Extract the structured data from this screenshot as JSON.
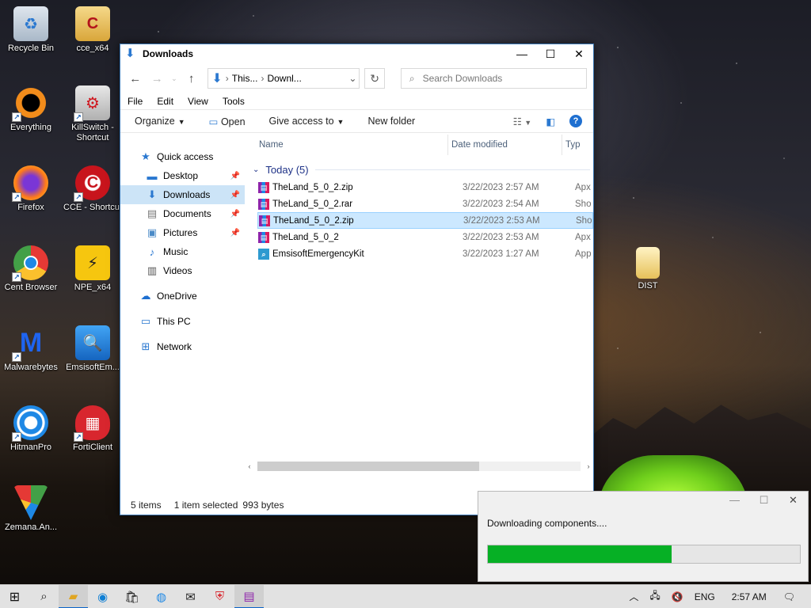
{
  "desktop": {
    "icons": [
      {
        "label": "Recycle Bin",
        "icon": "recycle-bin-icon"
      },
      {
        "label": "cce_x64",
        "icon": "archive-folder-icon"
      },
      {
        "label": "Everything",
        "icon": "everything-search-icon"
      },
      {
        "label": "KillSwitch - Shortcut",
        "icon": "killswitch-icon"
      },
      {
        "label": "Firefox",
        "icon": "firefox-icon"
      },
      {
        "label": "CCE - Shortcut",
        "icon": "cce-icon"
      },
      {
        "label": "Cent Browser",
        "icon": "cent-browser-icon"
      },
      {
        "label": "NPE_x64",
        "icon": "npe-icon"
      },
      {
        "label": "Malwarebytes",
        "icon": "malwarebytes-icon"
      },
      {
        "label": "EmsisoftEm...",
        "icon": "emsisoft-icon"
      },
      {
        "label": "HitmanPro",
        "icon": "hitmanpro-icon"
      },
      {
        "label": "FortiClient",
        "icon": "forticlient-icon"
      },
      {
        "label": "Zemana.An...",
        "icon": "zemana-icon"
      },
      {
        "label": "DIST",
        "icon": "folder-icon"
      }
    ]
  },
  "explorer": {
    "title": "Downloads",
    "address": {
      "part1": "This...",
      "part2": "Downl..."
    },
    "search_placeholder": "Search Downloads",
    "menu": [
      "File",
      "Edit",
      "View",
      "Tools"
    ],
    "commands": {
      "organize": "Organize",
      "open": "Open",
      "give_access": "Give access to",
      "new_folder": "New folder"
    },
    "nav": {
      "quick_access": "Quick access",
      "desktop": "Desktop",
      "downloads": "Downloads",
      "documents": "Documents",
      "pictures": "Pictures",
      "music": "Music",
      "videos": "Videos",
      "onedrive": "OneDrive",
      "this_pc": "This PC",
      "network": "Network"
    },
    "columns": {
      "name": "Name",
      "date": "Date modified",
      "type": "Typ"
    },
    "group_label": "Today (5)",
    "files": [
      {
        "name": "TheLand_5_0_2.zip",
        "date": "3/22/2023 2:57 AM",
        "type": "Apx"
      },
      {
        "name": "TheLand_5_0_2.rar",
        "date": "3/22/2023 2:54 AM",
        "type": "Sho"
      },
      {
        "name": "TheLand_5_0_2.zip",
        "date": "3/22/2023 2:53 AM",
        "type": "Sho"
      },
      {
        "name": "TheLand_5_0_2",
        "date": "3/22/2023 2:53 AM",
        "type": "Apx"
      },
      {
        "name": "EmsisoftEmergencyKit",
        "date": "3/22/2023 1:27 AM",
        "type": "App"
      }
    ],
    "status": {
      "count": "5 items",
      "selected": "1 item selected",
      "size": "993 bytes"
    }
  },
  "download_dialog": {
    "message": "Downloading components....",
    "progress": 0.59,
    "progress_color": "#06b025"
  },
  "taskbar": {
    "language": "ENG",
    "time": "2:57 AM"
  }
}
